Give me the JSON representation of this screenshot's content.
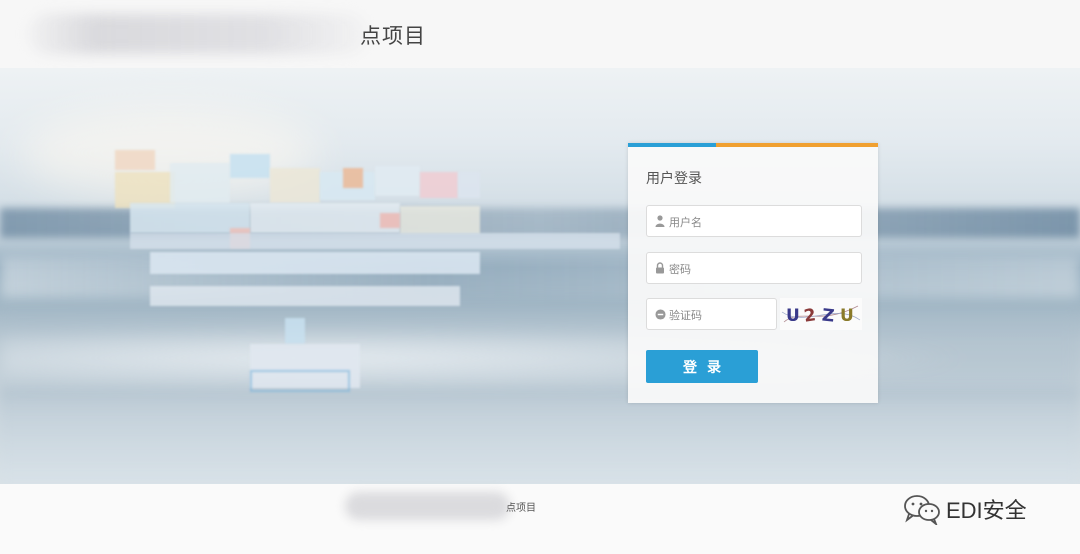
{
  "header": {
    "title_visible": "点项目"
  },
  "login": {
    "title": "用户登录",
    "username_placeholder": "用户名",
    "password_placeholder": "密码",
    "captcha_placeholder": "验证码",
    "captcha_text": [
      "U",
      "2",
      "Z",
      "U"
    ],
    "submit_label": "登录"
  },
  "footer": {
    "text_visible": "点项目"
  },
  "watermark": {
    "text": "EDI安全",
    "icon": "wechat-icon"
  },
  "colors": {
    "accent_blue": "#2a9fd6",
    "accent_orange": "#f0a030"
  }
}
